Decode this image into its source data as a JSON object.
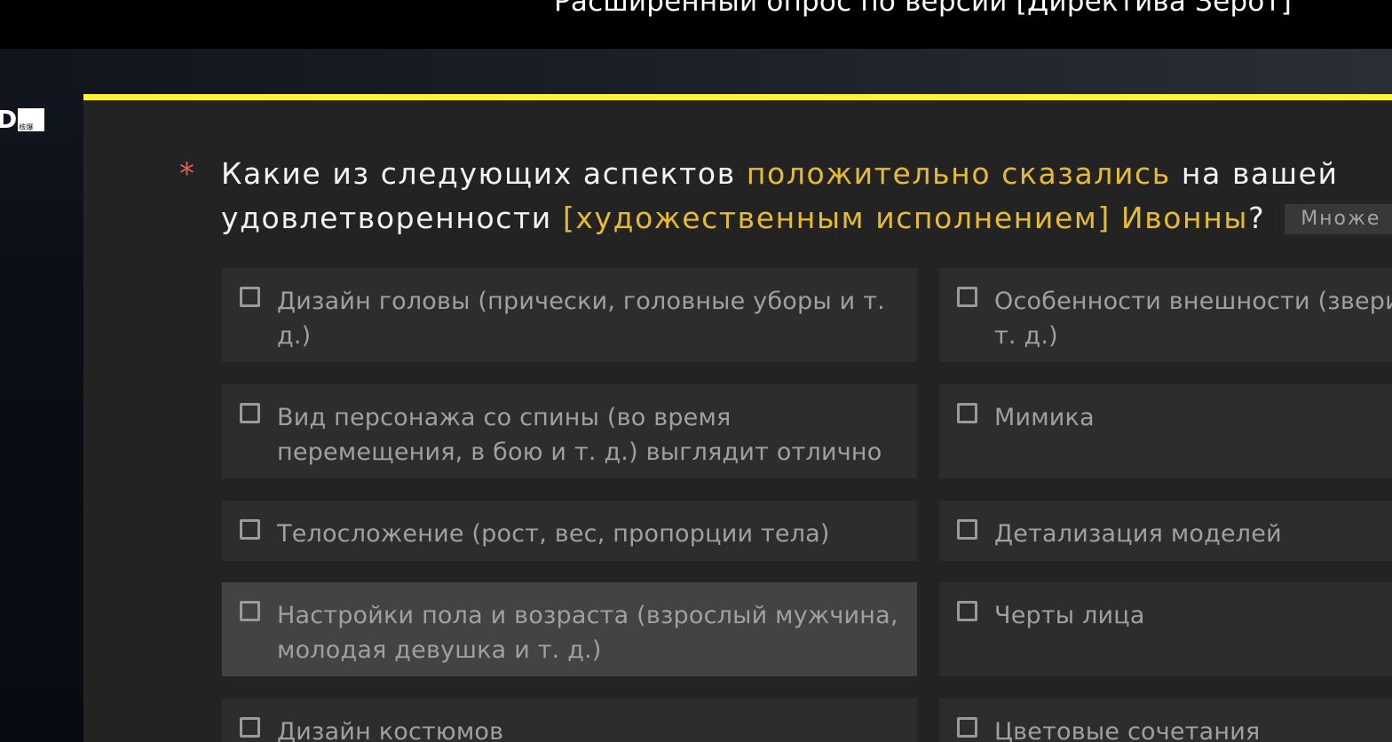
{
  "header": {
    "title": "Расширенный опрос по версии [Директива Зерот]"
  },
  "logo": {
    "letter": "D",
    "box_text": "核爆"
  },
  "question": {
    "required_mark": "*",
    "line1_before": "Какие из следующих аспектов ",
    "line1_highlight": "положительно сказались",
    "line1_after": " на вашей",
    "line2_before": "удовлетворенности ",
    "line2_highlight": "[художественным исполнением] Ивонны",
    "line2_after": "?",
    "type_badge": "Множе"
  },
  "options_left": [
    {
      "label": "Дизайн головы (прически, головные уборы и т. д.)",
      "checked": false
    },
    {
      "label": "Вид персонажа со спины (во время перемещения, в бою и т. д.) выглядит отлично",
      "checked": false
    },
    {
      "label": "Телосложение (рост, вес, пропорции тела)",
      "checked": false
    },
    {
      "label": "Настройки пола и возраста (взрослый мужчина, молодая девушка и т. д.)",
      "checked": false,
      "hovered": true
    },
    {
      "label": "Дизайн костюмов",
      "checked": false
    }
  ],
  "options_right": [
    {
      "label_line1": "Особенности внешности (зверины",
      "label_line2": "т. д.)",
      "checked": false
    },
    {
      "label_line1": "Мимика",
      "label_line2": "",
      "checked": false
    },
    {
      "label_line1": "Детализация моделей",
      "label_line2": "",
      "checked": false
    },
    {
      "label_line1": "Черты лица",
      "label_line2": "",
      "checked": false
    },
    {
      "label_line1": "Цветовые сочетания",
      "label_line2": "",
      "checked": false
    }
  ],
  "colors": {
    "accent_yellow": "#fff23a",
    "highlight_text": "#e6bb2f",
    "required_red": "#d9615b",
    "card_bg": "#232323",
    "option_bg": "#2d2d2d",
    "option_hover_bg": "#434343"
  }
}
